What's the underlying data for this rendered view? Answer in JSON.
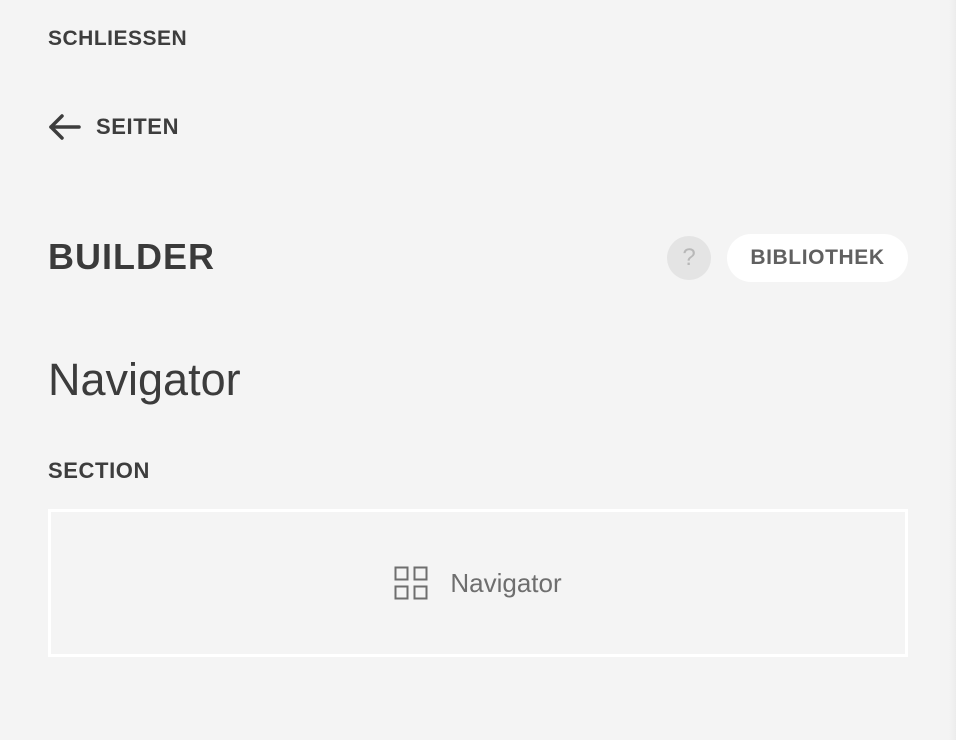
{
  "header": {
    "close_label": "SCHLIESSEN",
    "back_label": "SEITEN",
    "back_icon": "arrow-left-icon"
  },
  "builder": {
    "title": "BUILDER",
    "help_label": "?",
    "library_label": "BIBLIOTHEK"
  },
  "panel": {
    "title": "Navigator",
    "section_label": "SECTION",
    "widget": {
      "icon": "grid-icon",
      "label": "Navigator"
    }
  },
  "colors": {
    "background": "#f4f4f4",
    "text": "#3a3a3a",
    "button_bg": "#ffffff",
    "help_bg": "#e4e4e4"
  }
}
